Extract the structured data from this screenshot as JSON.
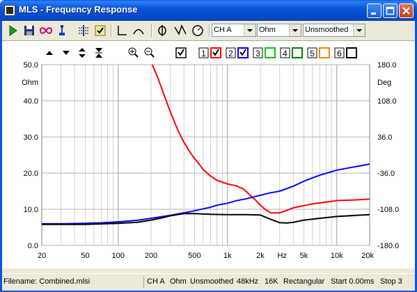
{
  "window": {
    "title": "MLS - Frequency Response"
  },
  "toolbar": {
    "channel": "CH A",
    "unit": "Ohm",
    "smoothing": "Unsmoothed"
  },
  "legend": {
    "traces": [
      {
        "number": "1",
        "color": "#ff0000",
        "checked": true
      },
      {
        "number": "2",
        "color": "#0000ff",
        "checked": true
      },
      {
        "number": "3",
        "color": "#00cc00",
        "checked": false
      },
      {
        "number": "4",
        "color": "#008000",
        "checked": false
      },
      {
        "number": "5",
        "color": "#ff8000",
        "checked": false
      },
      {
        "number": "6",
        "color": "#000000",
        "checked": false
      }
    ]
  },
  "chart_data": {
    "type": "line",
    "xlabel": "Hz",
    "xscale": "log",
    "xlim": [
      20,
      20000
    ],
    "x_ticks": [
      {
        "value": 20,
        "label": "20"
      },
      {
        "value": 50,
        "label": "50"
      },
      {
        "value": 100,
        "label": "100"
      },
      {
        "value": 200,
        "label": "200"
      },
      {
        "value": 500,
        "label": "500"
      },
      {
        "value": 1000,
        "label": "1k"
      },
      {
        "value": 2000,
        "label": "2k"
      },
      {
        "value": 5000,
        "label": "5k"
      },
      {
        "value": 10000,
        "label": "10k"
      },
      {
        "value": 20000,
        "label": "20k"
      }
    ],
    "y_left": {
      "unit_label": "Ohm",
      "ylim": [
        0,
        50
      ],
      "ticks": [
        "0.0",
        "10.0",
        "20.0",
        "30.0",
        "40.0",
        "50.0"
      ]
    },
    "y_right": {
      "unit_label": "Deg",
      "ylim": [
        -180,
        180
      ],
      "ticks": [
        "-180.0",
        "-108.0",
        "-36.0",
        "36.0",
        "108.0",
        "180.0"
      ]
    },
    "grid": true,
    "series": [
      {
        "color": "#ff0000",
        "axis": "left",
        "x": [
          205,
          230,
          260,
          300,
          350,
          400,
          450,
          500,
          550,
          600,
          700,
          800,
          900,
          1000,
          1200,
          1400,
          1500,
          1700,
          1800,
          1900,
          2000,
          2200,
          2500,
          2800,
          3000,
          3500,
          4000,
          5000,
          6000,
          8000,
          10000,
          15000,
          20000
        ],
        "y": [
          50,
          46.5,
          42,
          37,
          32,
          28.5,
          26,
          24,
          22.5,
          21,
          19.2,
          18,
          17.5,
          17,
          16.5,
          15.6,
          14.8,
          13.2,
          12.6,
          11.8,
          11.2,
          10,
          9,
          9,
          9,
          9.7,
          10.4,
          11,
          11.5,
          12,
          12.4,
          12.6,
          12.8
        ]
      },
      {
        "color": "#0000ff",
        "axis": "right",
        "x": [
          20,
          30,
          50,
          70,
          100,
          150,
          200,
          300,
          400,
          500,
          600,
          700,
          800,
          1000,
          1200,
          1500,
          2000,
          2500,
          3000,
          4000,
          5000,
          7000,
          10000,
          15000,
          20000
        ],
        "y": [
          -137,
          -137,
          -136,
          -135,
          -133,
          -130,
          -126,
          -120,
          -115,
          -111,
          -107,
          -104,
          -100,
          -96,
          -91,
          -87,
          -80,
          -75,
          -72,
          -62,
          -52,
          -40,
          -30,
          -23,
          -18
        ]
      },
      {
        "color": "#000000",
        "axis": "left",
        "x": [
          20,
          50,
          100,
          150,
          200,
          250,
          300,
          400,
          500,
          700,
          1000,
          1500,
          2000,
          2500,
          3000,
          3500,
          4000,
          5000,
          7000,
          10000,
          15000,
          20000
        ],
        "y": [
          5.8,
          5.8,
          6.1,
          6.4,
          7.0,
          7.6,
          8.2,
          8.8,
          8.8,
          8.6,
          8.5,
          8.5,
          8.4,
          7.2,
          6.3,
          6.2,
          6.4,
          7.0,
          7.5,
          8.0,
          8.3,
          8.5
        ]
      }
    ]
  },
  "status": {
    "filename": "Filename: Combined.mlsi",
    "channel": "CH A",
    "unit": "Ohm",
    "smoothing": "Unsmoothed",
    "rate": "48kHz",
    "size": "16K",
    "window": "Rectangular",
    "start": "Start 0.00ms",
    "stop": "Stop 3"
  }
}
